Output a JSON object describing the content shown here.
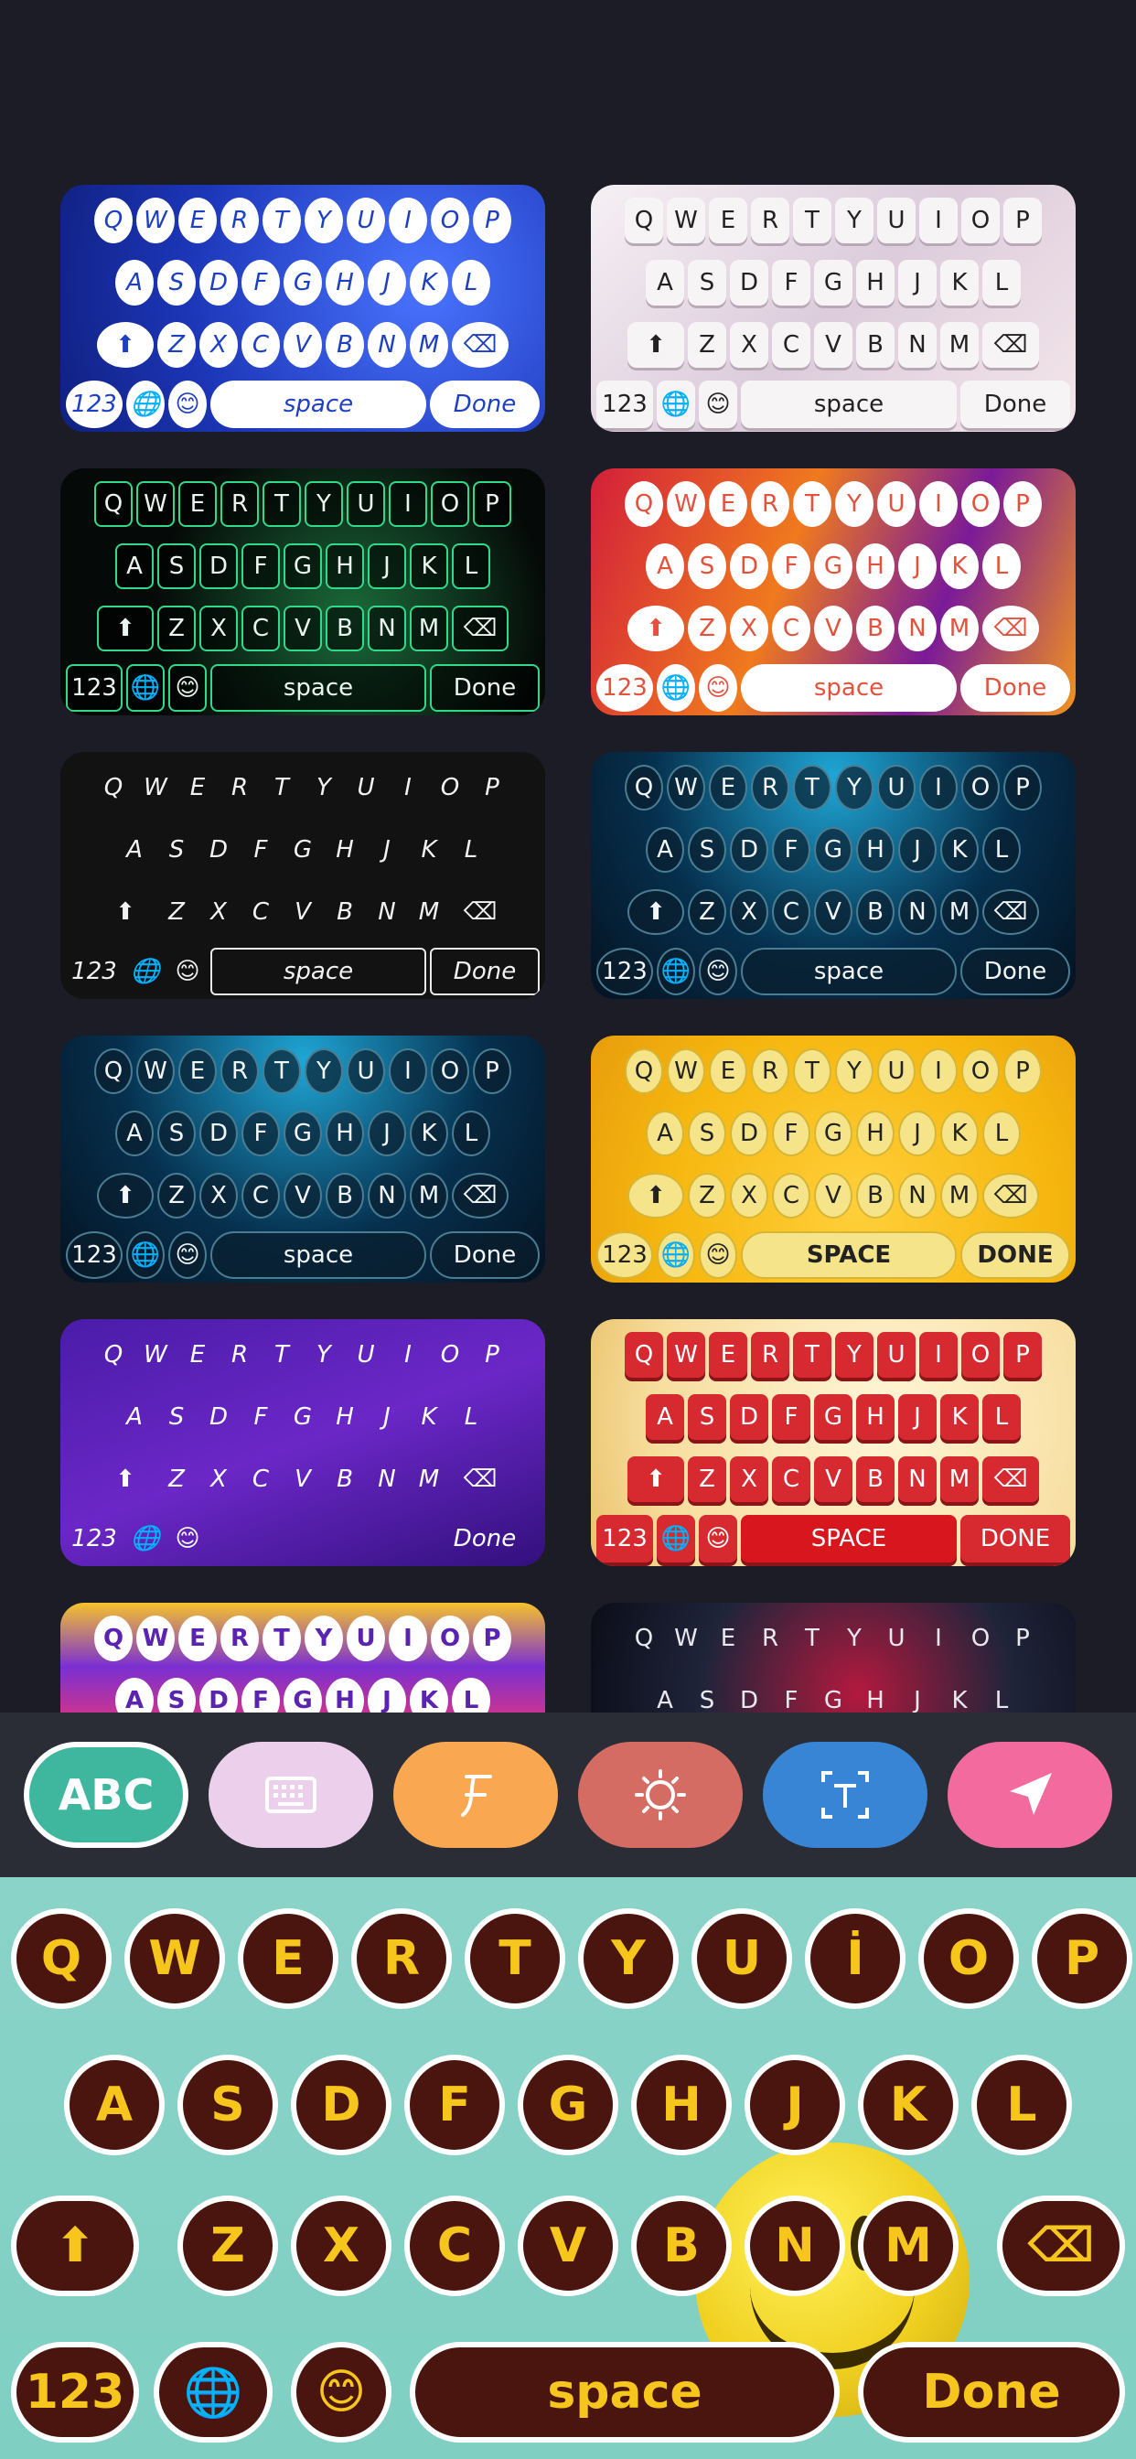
{
  "theme_rows": {
    "r1": [
      "Q",
      "W",
      "E",
      "R",
      "T",
      "Y",
      "U",
      "I",
      "O",
      "P"
    ],
    "r2": [
      "A",
      "S",
      "D",
      "F",
      "G",
      "H",
      "J",
      "K",
      "L"
    ],
    "r3": [
      "Z",
      "X",
      "C",
      "V",
      "B",
      "N",
      "M"
    ]
  },
  "themes": [
    {
      "id": "t1",
      "num": "123",
      "space": "space",
      "done": "Done"
    },
    {
      "id": "t2",
      "num": "123",
      "space": "space",
      "done": "Done"
    },
    {
      "id": "t3",
      "num": "123",
      "space": "space",
      "done": "Done"
    },
    {
      "id": "t4",
      "num": "123",
      "space": "space",
      "done": "Done"
    },
    {
      "id": "t5",
      "num": "123",
      "space": "space",
      "done": "Done"
    },
    {
      "id": "t6",
      "num": "123",
      "space": "space",
      "done": "Done"
    },
    {
      "id": "t7",
      "num": "123",
      "space": "space",
      "done": "Done"
    },
    {
      "id": "t8",
      "num": "123",
      "space": "SPACE",
      "done": "DONE"
    },
    {
      "id": "t9",
      "num": "123",
      "space": "",
      "done": "Done"
    },
    {
      "id": "t10",
      "num": "123",
      "space": "SPACE",
      "done": "DONE"
    },
    {
      "id": "t11",
      "num": "",
      "space": "",
      "done": ""
    },
    {
      "id": "t12",
      "num": "",
      "space": "",
      "done": ""
    }
  ],
  "toolbar": {
    "abc_label": "ABC",
    "icons": [
      "keyboard-icon",
      "font-icon",
      "effect-icon",
      "text-icon",
      "send-icon"
    ],
    "colors": [
      "#eccfea",
      "#f9a851",
      "#d46c64",
      "#3885d6",
      "#f36b9e"
    ]
  },
  "keyboard": {
    "row1": [
      "Q",
      "W",
      "E",
      "R",
      "T",
      "Y",
      "U",
      "İ",
      "O",
      "P"
    ],
    "row2": [
      "A",
      "S",
      "D",
      "F",
      "G",
      "H",
      "J",
      "K",
      "L"
    ],
    "row3": [
      "Z",
      "X",
      "C",
      "V",
      "B",
      "N",
      "M"
    ],
    "num_label": "123",
    "space_label": "space",
    "done_label": "Done",
    "key_color": "#4a150f",
    "letter_color": "#f6c61d",
    "background": "#8ad3c8"
  }
}
